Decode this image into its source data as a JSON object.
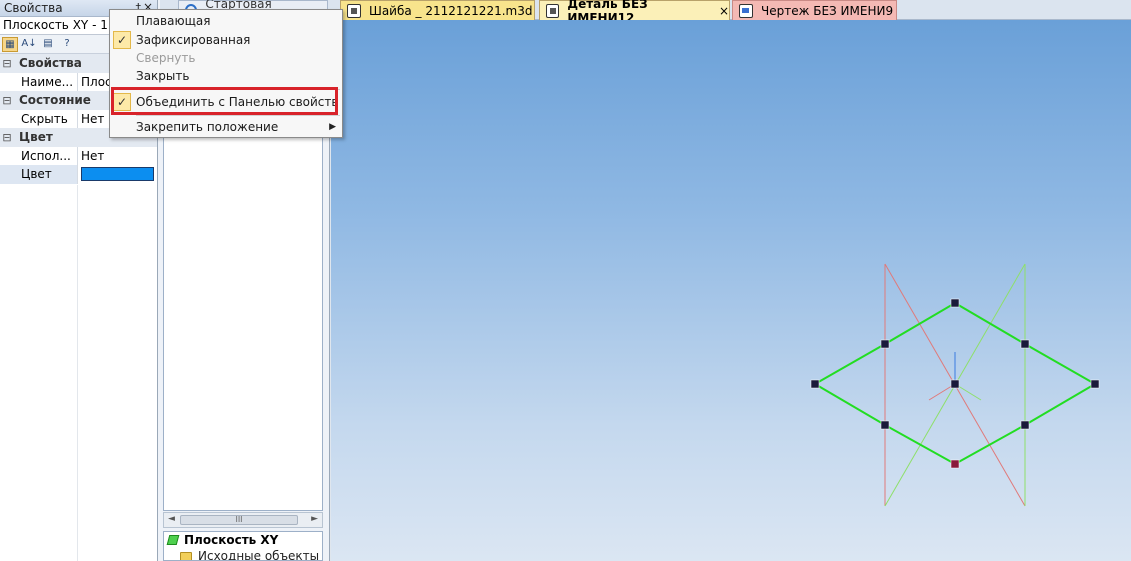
{
  "properties_panel": {
    "title": "Свойства",
    "pin": "†",
    "close": "×",
    "object_selector": "Плоскость XY - 1",
    "rows": [
      {
        "type": "category",
        "expander": "⊟",
        "label": "Свойства"
      },
      {
        "type": "item",
        "key": "Наиме...",
        "value": "Плос"
      },
      {
        "type": "category",
        "expander": "⊟",
        "label": "Состояние"
      },
      {
        "type": "item",
        "key": "Скрыть",
        "value": "Нет"
      },
      {
        "type": "category",
        "expander": "⊟",
        "label": "Цвет"
      },
      {
        "type": "item",
        "key": "Испол...",
        "value": "Нет"
      },
      {
        "type": "item",
        "key": "Цвет",
        "value": ""
      }
    ],
    "color_value": "#0c8ef0"
  },
  "tabs": [
    {
      "label": "Стартовая страница",
      "icon": "start-page-icon"
    },
    {
      "label": "Шайба _ 2112121221.m3d",
      "icon": "part-document-icon"
    },
    {
      "label": "Деталь БЕЗ ИМЕНИ12",
      "icon": "part-document-icon",
      "close": "×"
    },
    {
      "label": "Чертеж БЕЗ ИМЕНИ9",
      "icon": "drawing-document-icon"
    }
  ],
  "tree_panel": {
    "scroll_thumb": "III",
    "scroll_left": "◄",
    "scroll_right": "►",
    "root_item": "Плоскость XY",
    "child_item": "Исходные объекты"
  },
  "context_menu": {
    "items": [
      {
        "label": "Плавающая",
        "checked": false,
        "disabled": false
      },
      {
        "label": "Зафиксированная",
        "checked": true,
        "disabled": false
      },
      {
        "label": "Свернуть",
        "checked": false,
        "disabled": true
      },
      {
        "label": "Закрыть",
        "checked": false,
        "disabled": false
      },
      {
        "label": "Объединить с Панелью свойств",
        "checked": true,
        "disabled": false
      },
      {
        "label": "Закрепить положение",
        "checked": false,
        "disabled": false,
        "submenu": true
      }
    ],
    "check_mark": "✓",
    "submenu_arrow": "▶"
  },
  "colors": {
    "highlight": "#d8232a",
    "sketch_green": "#22dd22",
    "plane_red": "#e07a7a",
    "plane_green": "#8ee06a"
  }
}
